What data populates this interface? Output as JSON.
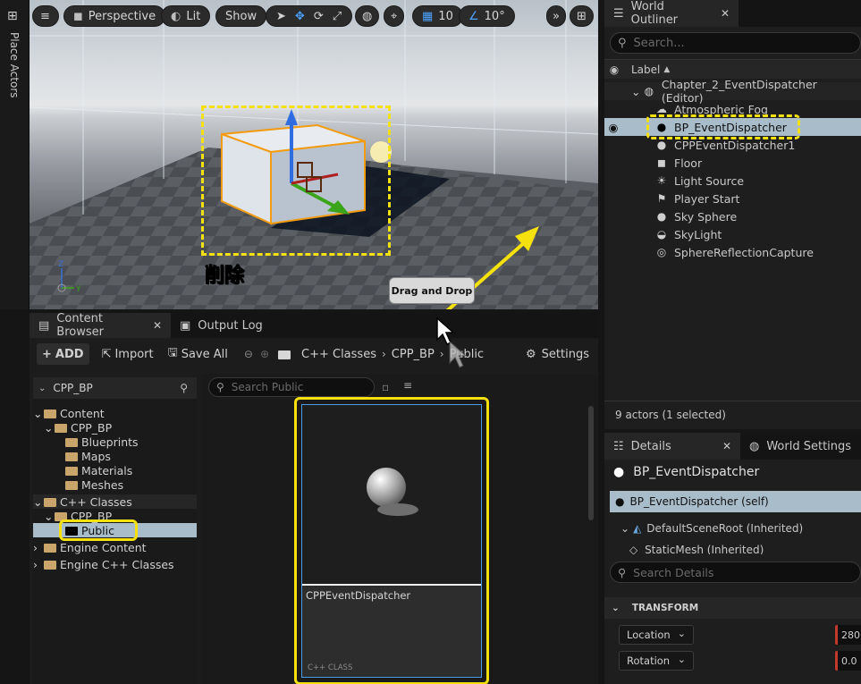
{
  "place_actors": {
    "label": "Place Actors"
  },
  "viewport": {
    "perspective_label": "Perspective",
    "lit_label": "Lit",
    "show_label": "Show",
    "grid_snap_value": "10",
    "angle_snap_value": "10°",
    "annotation_delete": "削除",
    "tooltip_drag_drop": "Drag and Drop"
  },
  "outliner": {
    "tab_label": "World Outliner",
    "search_placeholder": "Search...",
    "column_label": "Label",
    "level_name": "Chapter_2_EventDispatcher (Editor)",
    "items": [
      {
        "label": "Atmospheric Fog",
        "icon": "fog-icon"
      },
      {
        "label": "BP_EventDispatcher",
        "icon": "sphere-actor-icon",
        "selected": true
      },
      {
        "label": "CPPEventDispatcher1",
        "icon": "sphere-actor-icon"
      },
      {
        "label": "Floor",
        "icon": "cube-icon"
      },
      {
        "label": "Light Source",
        "icon": "sun-icon"
      },
      {
        "label": "Player Start",
        "icon": "flag-icon"
      },
      {
        "label": "Sky Sphere",
        "icon": "sphere-actor-icon"
      },
      {
        "label": "SkyLight",
        "icon": "skylight-icon"
      },
      {
        "label": "SphereReflectionCapture",
        "icon": "reflection-icon"
      }
    ],
    "status": "9 actors (1 selected)"
  },
  "content_browser": {
    "tab_label": "Content Browser",
    "output_log_label": "Output Log",
    "add_label": "ADD",
    "import_label": "Import",
    "save_all_label": "Save All",
    "breadcrumb": [
      "C++ Classes",
      "CPP_BP",
      "Public"
    ],
    "settings_label": "Settings",
    "source_root": "CPP_BP",
    "search_placeholder": "Search Public",
    "tree": {
      "content": "Content",
      "cpp_bp": "CPP_BP",
      "blueprints": "Blueprints",
      "maps": "Maps",
      "materials": "Materials",
      "meshes": "Meshes",
      "cpp_classes": "C++ Classes",
      "cpp_bp_class": "CPP_BP",
      "public": "Public",
      "engine_content": "Engine Content",
      "engine_cpp": "Engine C++ Classes"
    },
    "asset": {
      "name": "CPPEventDispatcher",
      "type": "C++ CLASS"
    }
  },
  "details": {
    "tab_label": "Details",
    "world_settings_label": "World Settings",
    "actor_name": "BP_EventDispatcher",
    "self_label": "BP_EventDispatcher (self)",
    "root_label": "DefaultSceneRoot (Inherited)",
    "mesh_label": "StaticMesh (Inherited)",
    "search_placeholder": "Search Details",
    "section_transform": "TRANSFORM",
    "location_label": "Location",
    "rotation_label": "Rotation",
    "location_x": "280",
    "rotation_x": "0.0"
  },
  "colors": {
    "annotation_yellow": "#f5e10d",
    "selection_blue": "#a9bcc9",
    "folder_tan": "#c9a56b"
  }
}
